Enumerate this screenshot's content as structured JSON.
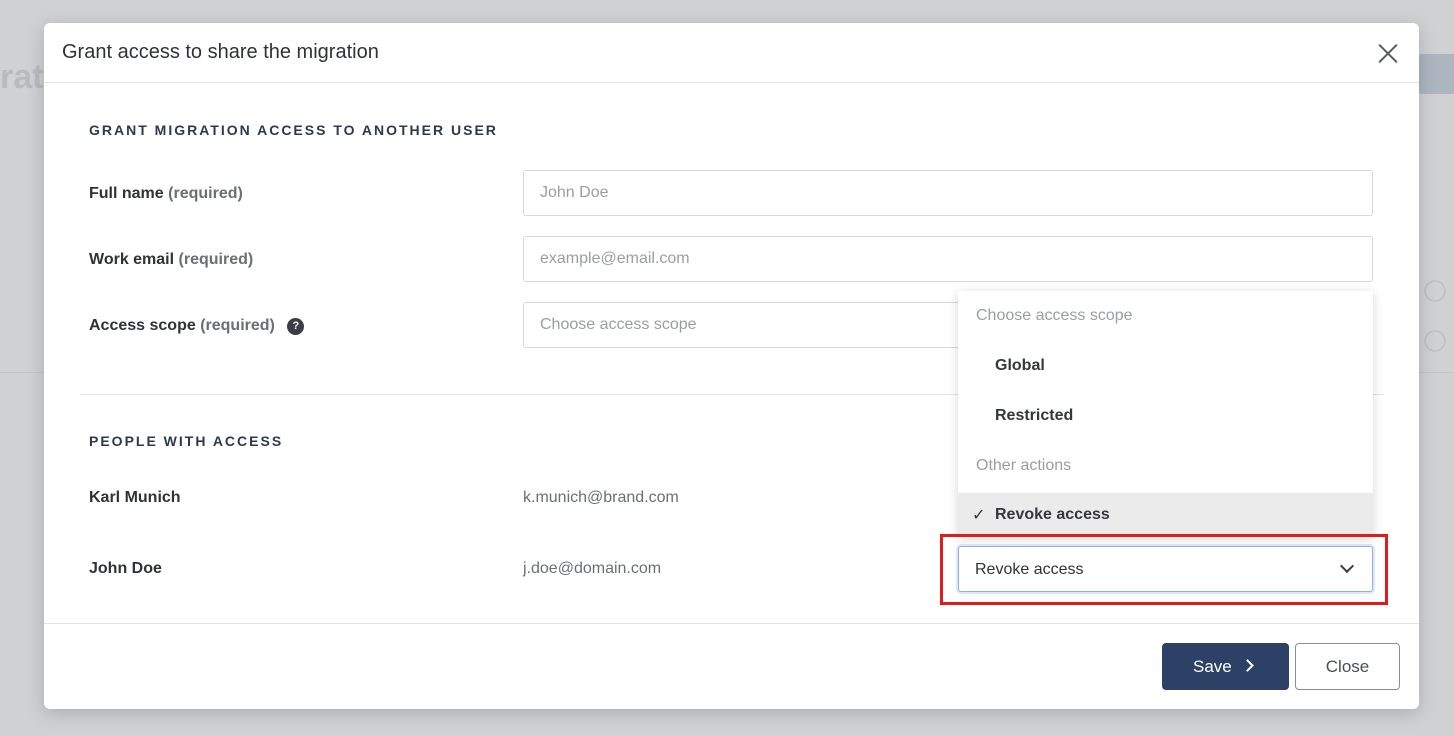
{
  "background": {
    "title": "rat"
  },
  "modal": {
    "title": "Grant access to share the migration",
    "close_icon": "close-icon"
  },
  "grant_section": {
    "title": "GRANT MIGRATION ACCESS TO ANOTHER USER",
    "full_name": {
      "label": "Full name",
      "required": "(required)",
      "placeholder": "John Doe",
      "value": ""
    },
    "work_email": {
      "label": "Work email",
      "required": "(required)",
      "placeholder": "example@email.com",
      "value": ""
    },
    "access_scope": {
      "label": "Access scope",
      "required": "(required)",
      "help_icon": "?",
      "placeholder": "Choose access scope",
      "value": ""
    }
  },
  "people_section": {
    "title": "PEOPLE WITH ACCESS",
    "people": [
      {
        "name": "Karl Munich",
        "email": "k.munich@brand.com"
      },
      {
        "name": "John Doe",
        "email": "j.doe@domain.com",
        "action": "Revoke access"
      }
    ]
  },
  "dropdown": {
    "group_scope": "Choose access scope",
    "items_scope": [
      "Global",
      "Restricted"
    ],
    "group_other": "Other actions",
    "selected_item": "Revoke access",
    "check_icon": "✓"
  },
  "footer": {
    "save_label": "Save",
    "close_label": "Close"
  },
  "colors": {
    "primary": "#2c4165",
    "highlight": "#e01d1d"
  }
}
